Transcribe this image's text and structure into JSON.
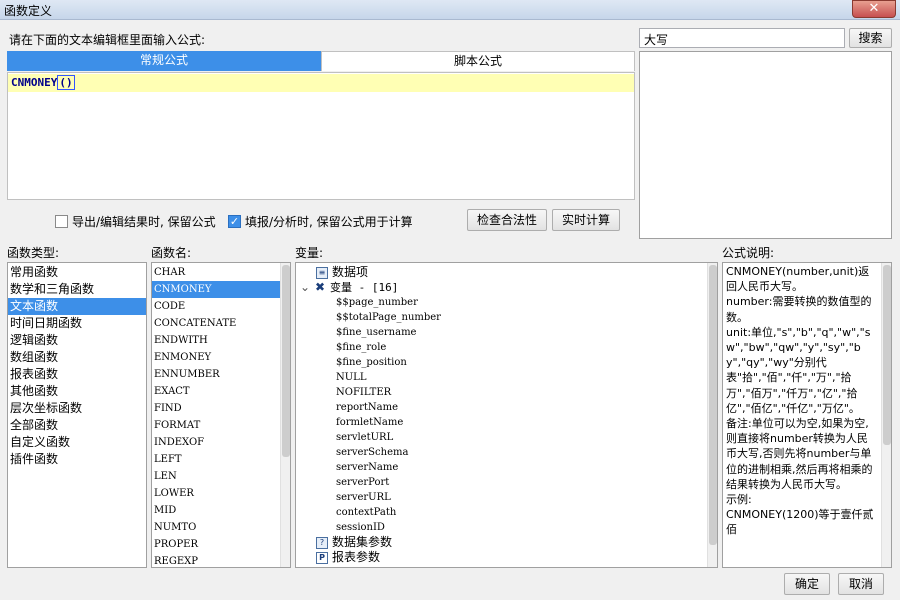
{
  "window": {
    "title": "函数定义",
    "close": "✕"
  },
  "prompt": "请在下面的文本编辑框里面输入公式:",
  "search": {
    "value": "大写",
    "button": "搜索"
  },
  "tabs": [
    {
      "label": "常规公式",
      "active": true
    },
    {
      "label": "脚本公式",
      "active": false
    }
  ],
  "editor": {
    "code": "CNMONEY",
    "paren": "()"
  },
  "options": {
    "export_keep": {
      "label": "导出/编辑结果时, 保留公式",
      "checked": false
    },
    "fill_keep": {
      "label": "填报/分析时, 保留公式用于计算",
      "checked": true
    }
  },
  "buttons": {
    "check": "检查合法性",
    "realtime": "实时计算",
    "ok": "确定",
    "cancel": "取消"
  },
  "section_labels": {
    "types": "函数类型:",
    "names": "函数名:",
    "vars": "变量:",
    "desc": "公式说明:"
  },
  "function_types": [
    "常用函数",
    "数学和三角函数",
    "文本函数",
    "时间日期函数",
    "逻辑函数",
    "数组函数",
    "报表函数",
    "其他函数",
    "层次坐标函数",
    "全部函数",
    "自定义函数",
    "插件函数"
  ],
  "selected_type": "文本函数",
  "function_names": [
    "CHAR",
    "CNMONEY",
    "CODE",
    "CONCATENATE",
    "ENDWITH",
    "ENMONEY",
    "ENNUMBER",
    "EXACT",
    "FIND",
    "FORMAT",
    "INDEXOF",
    "LEFT",
    "LEN",
    "LOWER",
    "MID",
    "NUMTO",
    "PROPER",
    "REGEXP"
  ],
  "selected_name": "CNMONEY",
  "variables": {
    "data_item": "数据项",
    "var_group": "变量 - [16]",
    "vars": [
      "$$page_number",
      "$$totalPage_number",
      "$fine_username",
      "$fine_role",
      "$fine_position",
      "NULL",
      "NOFILTER",
      "reportName",
      "formletName",
      "servletURL",
      "serverSchema",
      "serverName",
      "serverPort",
      "serverURL",
      "contextPath",
      "sessionID"
    ],
    "dataset_params": "数据集参数",
    "report_params": "报表参数"
  },
  "description": "CNMONEY(number,unit)返回人民币大写。\nnumber:需要转换的数值型的数。\nunit:单位,\"s\",\"b\",\"q\",\"w\",\"sw\",\"bw\",\"qw\",\"y\",\"sy\",\"by\",\"qy\",\"wy\"分别代表\"拾\",\"佰\",\"仟\",\"万\",\"拾万\",\"佰万\",\"仟万\",\"亿\",\"拾亿\",\"佰亿\",\"仟亿\",\"万亿\"。\n备注:单位可以为空,如果为空,则直接将number转换为人民币大写,否则先将number与单位的进制相乘,然后再将相乘的结果转换为人民币大写。\n示例:\nCNMONEY(1200)等于壹仟贰佰"
}
